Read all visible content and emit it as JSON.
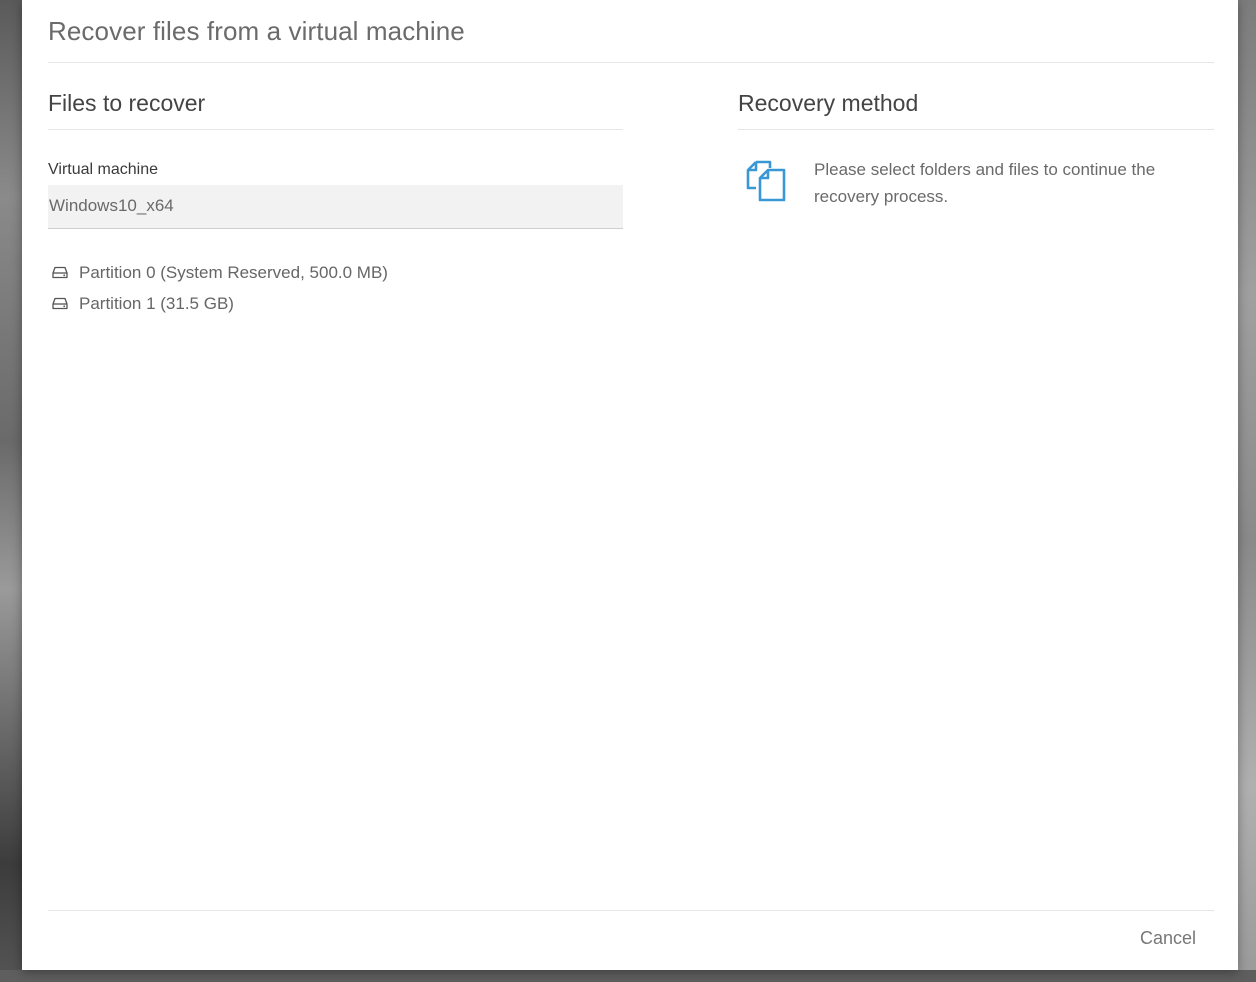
{
  "dialog": {
    "title": "Recover files from a virtual machine"
  },
  "files_to_recover": {
    "title": "Files to recover",
    "vm_label": "Virtual machine",
    "vm_value": "Windows10_x64",
    "partitions": [
      {
        "label": "Partition 0 (System Reserved, 500.0 MB)",
        "icon": "hard-drive-icon"
      },
      {
        "label": "Partition 1 (31.5 GB)",
        "icon": "hard-drive-icon"
      }
    ]
  },
  "recovery_method": {
    "title": "Recovery method",
    "icon": "copy-files-icon",
    "message": "Please select folders and files to continue the recovery process."
  },
  "footer": {
    "cancel_label": "Cancel"
  },
  "colors": {
    "accent": "#3a97d6"
  }
}
